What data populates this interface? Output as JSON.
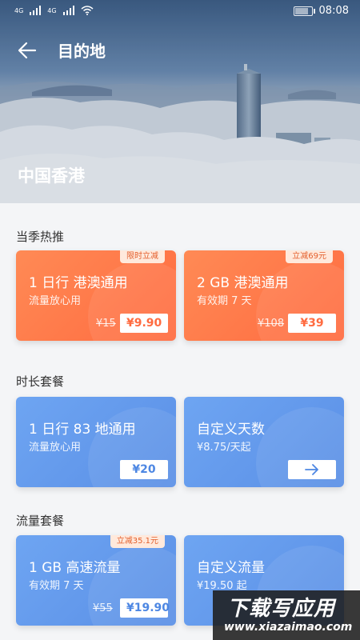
{
  "status_bar": {
    "signal_1": "4G",
    "signal_2": "4G",
    "time": "08:08"
  },
  "header": {
    "title": "目的地",
    "destination": "中国香港"
  },
  "sections": {
    "hot": "当季热推",
    "duration": "时长套餐",
    "data": "流量套餐"
  },
  "cards": {
    "hot_1": {
      "name": "1 日行  港澳通用",
      "sub": "流量放心用",
      "tag": "限时立减",
      "old_price": "¥15",
      "price": "¥9.90"
    },
    "hot_2": {
      "name": "2 GB 港澳通用",
      "sub": "有效期 7 天",
      "tag": "立减69元",
      "old_price": "¥108",
      "price": "¥39"
    },
    "dur_1": {
      "name": "1 日行  83 地通用",
      "sub": "流量放心用",
      "price": "¥20"
    },
    "dur_2": {
      "name": "自定义天数",
      "sub": "¥8.75/天起"
    },
    "data_1": {
      "name": "1 GB 高速流量",
      "sub": "有效期 7 天",
      "tag": "立减35.1元",
      "old_price": "¥55",
      "price": "¥19.90"
    },
    "data_2": {
      "name": "自定义流量",
      "sub": "¥19.50 起"
    }
  },
  "watermark": {
    "main": "下载写应用",
    "sub": "www.xiazaimao.com"
  },
  "colors": {
    "orange": "#ff6b40",
    "blue": "#5a8fe6",
    "tag_bg": "#ffe9dc"
  }
}
